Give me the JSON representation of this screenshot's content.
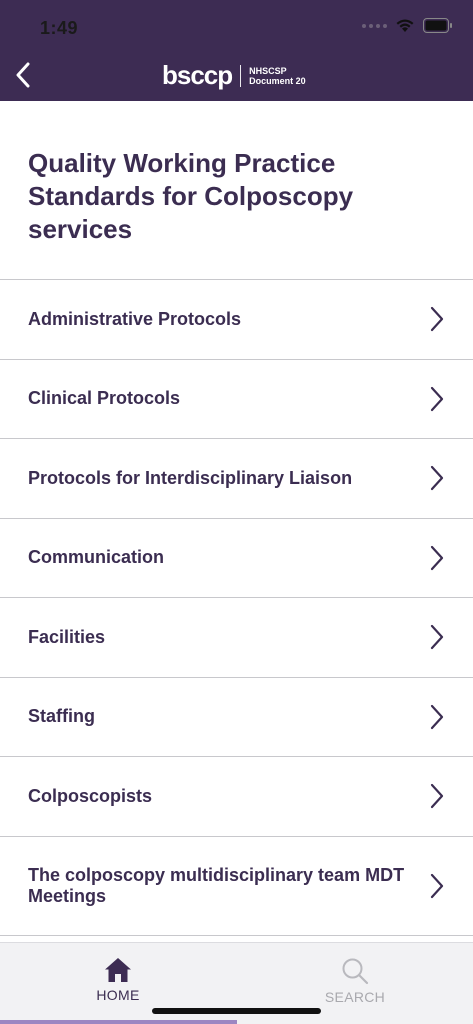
{
  "status_bar": {
    "time": "1:49"
  },
  "nav": {
    "logo_text": "bsccp",
    "logo_sub_line1": "NHSCSP",
    "logo_sub_line2": "Document 20"
  },
  "page": {
    "title": "Quality Working Practice Standards for Colposcopy services"
  },
  "menu": [
    {
      "label": "Administrative Protocols"
    },
    {
      "label": "Clinical Protocols"
    },
    {
      "label": "Protocols for Interdisciplinary Liaison"
    },
    {
      "label": "Communication"
    },
    {
      "label": "Facilities"
    },
    {
      "label": "Staffing"
    },
    {
      "label": "Colposcopists"
    },
    {
      "label": "The colposcopy multidisciplinary team MDT Meetings"
    }
  ],
  "tabs": {
    "home": {
      "label": "HOME",
      "icon": "home-icon"
    },
    "search": {
      "label": "SEARCH",
      "icon": "search-icon"
    }
  },
  "colors": {
    "brand": "#3d2c53",
    "text": "#3b2d51",
    "inactive_tab": "#a9a9ae",
    "accent": "#9c86c2"
  }
}
